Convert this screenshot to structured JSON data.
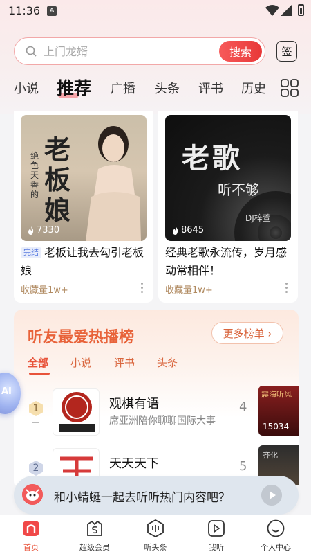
{
  "status_bar": {
    "time": "11:36",
    "notif_letter": "A"
  },
  "search": {
    "placeholder": "上门龙婿",
    "button_label": "搜索",
    "sign_label": "签"
  },
  "tabs": [
    {
      "label": "小说"
    },
    {
      "label": "推荐"
    },
    {
      "label": "广播"
    },
    {
      "label": "头条"
    },
    {
      "label": "评书"
    },
    {
      "label": "历史"
    }
  ],
  "cards": [
    {
      "cover_title": "老板娘",
      "cover_subtitle": "绝色天香的",
      "plays": "7330",
      "badge": "完结",
      "title": "老板让我去勾引老板娘",
      "collect": "收藏量1w+"
    },
    {
      "cover_title": "老歌",
      "cover_subtitle": "听不够",
      "cover_tag": "DJ梓萱",
      "plays": "8645",
      "title": "经典老歌永流传，岁月感动常相伴！",
      "collect": "收藏量1w+"
    }
  ],
  "ranking": {
    "title": "听友最爱热播榜",
    "more_label": "更多榜单 ›",
    "tabs": [
      "全部",
      "小说",
      "评书",
      "头条"
    ],
    "items": [
      {
        "rank": "1",
        "cover_text": "观棋有语",
        "name": "观棋有语",
        "desc": "席亚洲陪你聊聊国际大事",
        "next_rank": "4",
        "side_count": "15034",
        "side_text": "震海听风"
      },
      {
        "rank": "2",
        "cover_text": "天天天下",
        "name": "天天天下",
        "desc": "",
        "next_rank": "5",
        "side_text": "齐化"
      }
    ]
  },
  "ai_float": {
    "label": "AI"
  },
  "chat": {
    "text": "和小蜻蜓一起去听听热门内容吧？"
  },
  "bottom_nav": [
    {
      "label": "首页",
      "icon": "home-icon",
      "active": true
    },
    {
      "label": "超级会员",
      "icon": "vip-icon"
    },
    {
      "label": "听头条",
      "icon": "headline-icon"
    },
    {
      "label": "我听",
      "icon": "my-listen-icon"
    },
    {
      "label": "个人中心",
      "icon": "profile-icon"
    }
  ],
  "colors": {
    "accent": "#e8533a",
    "search_button": "#ef4545",
    "rank_title": "#e8633a"
  }
}
